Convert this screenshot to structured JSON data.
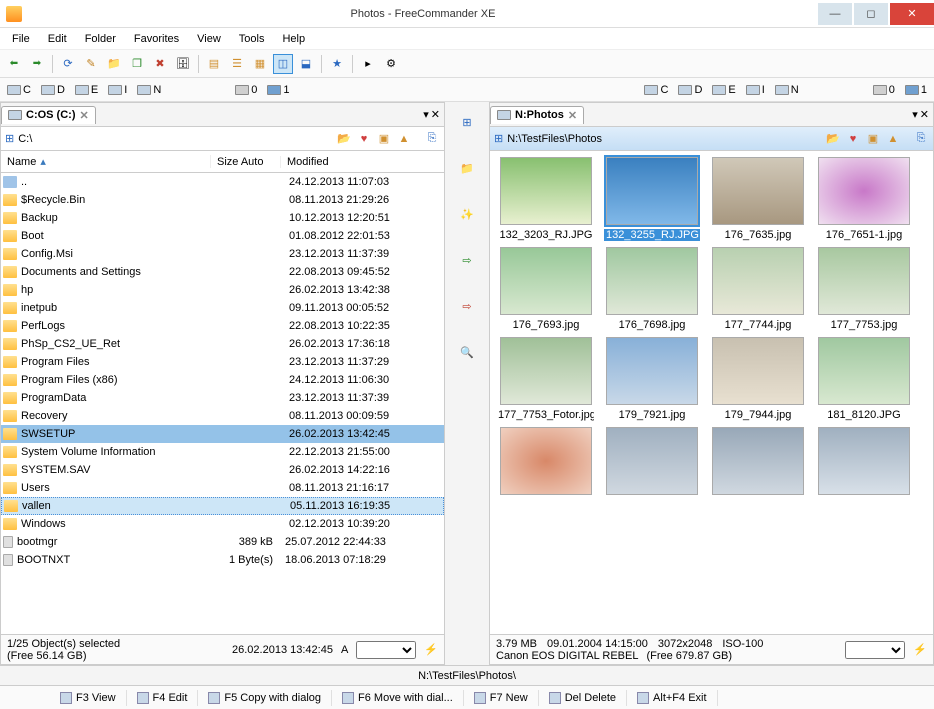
{
  "title": "Photos - FreeCommander XE",
  "menus": [
    "File",
    "Edit",
    "Folder",
    "Favorites",
    "View",
    "Tools",
    "Help"
  ],
  "drives_left": [
    {
      "id": "C",
      "label": "C"
    },
    {
      "id": "D",
      "label": "D"
    },
    {
      "id": "E",
      "label": "E"
    },
    {
      "id": "I",
      "label": "I"
    },
    {
      "id": "N",
      "label": "N"
    }
  ],
  "drives_left_extra": [
    "0",
    "1"
  ],
  "drives_right_extra": [
    "0",
    "1"
  ],
  "left": {
    "tab": "C:OS (C:)",
    "path": "C:\\",
    "columns": {
      "name": "Name",
      "size": "Size Auto",
      "modified": "Modified"
    },
    "rows": [
      {
        "name": "..",
        "size": "",
        "mod": "24.12.2013 11:07:03",
        "icon": "up"
      },
      {
        "name": "$Recycle.Bin",
        "size": "",
        "mod": "08.11.2013 21:29:26"
      },
      {
        "name": "Backup",
        "size": "",
        "mod": "10.12.2013 12:20:51"
      },
      {
        "name": "Boot",
        "size": "",
        "mod": "01.08.2012 22:01:53"
      },
      {
        "name": "Config.Msi",
        "size": "",
        "mod": "23.12.2013 11:37:39"
      },
      {
        "name": "Documents and Settings",
        "size": "",
        "mod": "22.08.2013 09:45:52"
      },
      {
        "name": "hp",
        "size": "",
        "mod": "26.02.2013 13:42:38"
      },
      {
        "name": "inetpub",
        "size": "",
        "mod": "09.11.2013 00:05:52"
      },
      {
        "name": "PerfLogs",
        "size": "",
        "mod": "22.08.2013 10:22:35"
      },
      {
        "name": "PhSp_CS2_UE_Ret",
        "size": "",
        "mod": "26.02.2013 17:36:18"
      },
      {
        "name": "Program Files",
        "size": "",
        "mod": "23.12.2013 11:37:29"
      },
      {
        "name": "Program Files (x86)",
        "size": "",
        "mod": "24.12.2013 11:06:30"
      },
      {
        "name": "ProgramData",
        "size": "",
        "mod": "23.12.2013 11:37:39"
      },
      {
        "name": "Recovery",
        "size": "",
        "mod": "08.11.2013 00:09:59"
      },
      {
        "name": "SWSETUP",
        "size": "",
        "mod": "26.02.2013 13:42:45",
        "state": "sel"
      },
      {
        "name": "System Volume Information",
        "size": "",
        "mod": "22.12.2013 21:55:00"
      },
      {
        "name": "SYSTEM.SAV",
        "size": "",
        "mod": "26.02.2013 14:22:16"
      },
      {
        "name": "Users",
        "size": "",
        "mod": "08.11.2013 21:16:17"
      },
      {
        "name": "vallen",
        "size": "",
        "mod": "05.11.2013 16:19:35",
        "state": "hover"
      },
      {
        "name": "Windows",
        "size": "",
        "mod": "02.12.2013 10:39:20"
      },
      {
        "name": "bootmgr",
        "size": "389 kB",
        "mod": "25.07.2012 22:44:33",
        "icon": "file"
      },
      {
        "name": "BOOTNXT",
        "size": "1 Byte(s)",
        "mod": "18.06.2013 07:18:29",
        "icon": "file"
      }
    ],
    "status1": "1/25 Object(s) selected",
    "status_date": "26.02.2013 13:42:45",
    "status_attr": "A",
    "status2": "(Free 56.14 GB)"
  },
  "right": {
    "tab": "N:Photos",
    "path": "N:\\TestFiles\\Photos",
    "thumbs": [
      {
        "name": "132_3203_RJ.JPG",
        "bg": "linear-gradient(#88c070,#e8f0d0)"
      },
      {
        "name": "132_3255_RJ.JPG",
        "bg": "linear-gradient(#3a80c0,#80b8e8)",
        "sel": true
      },
      {
        "name": "176_7635.jpg",
        "bg": "linear-gradient(#d0c8b8,#a89880)"
      },
      {
        "name": "176_7651-1.jpg",
        "bg": "radial-gradient(#c878c8,#f0e0f0)"
      },
      {
        "name": "176_7693.jpg",
        "bg": "linear-gradient(#98c898,#d8e8d0)"
      },
      {
        "name": "176_7698.jpg",
        "bg": "linear-gradient(#a0c8a0,#e0e8d8)"
      },
      {
        "name": "177_7744.jpg",
        "bg": "linear-gradient(#b8d0b0,#e8e8d8)"
      },
      {
        "name": "177_7753.jpg",
        "bg": "linear-gradient(#a8c8a0,#e0e8d8)"
      },
      {
        "name": "177_7753_Fotor.jpg",
        "bg": "linear-gradient(#a0c098,#e0e8d8)"
      },
      {
        "name": "179_7921.jpg",
        "bg": "linear-gradient(#88b0d8,#c8d8e8)"
      },
      {
        "name": "179_7944.jpg",
        "bg": "linear-gradient(#c8c0b0,#e8e0d0)"
      },
      {
        "name": "181_8120.JPG",
        "bg": "linear-gradient(#a0c8a0,#d8e8d0)"
      },
      {
        "name": "",
        "bg": "radial-gradient(#d88868,#f0d0c0)"
      },
      {
        "name": "",
        "bg": "linear-gradient(#a0b0c0,#d0d8e0)"
      },
      {
        "name": "",
        "bg": "linear-gradient(#98a8b8,#d0d8e0)"
      },
      {
        "name": "",
        "bg": "linear-gradient(#a0b0c0,#d8e0e8)"
      }
    ],
    "status_size": "3.79 MB",
    "status_date": "09.01.2004 14:15:00",
    "status_dim": "3072x2048",
    "status_iso": "ISO-100",
    "status_camera": "Canon EOS DIGITAL REBEL",
    "status_free": "(Free 679.87 GB)"
  },
  "path_status": "N:\\TestFiles\\Photos\\",
  "fn": [
    {
      "key": "F3",
      "label": "View"
    },
    {
      "key": "F4",
      "label": "Edit"
    },
    {
      "key": "F5",
      "label": "Copy with dialog"
    },
    {
      "key": "F6",
      "label": "Move with dial..."
    },
    {
      "key": "F7",
      "label": "New"
    },
    {
      "key": "",
      "label": "Del Delete"
    },
    {
      "key": "Alt+F4",
      "label": "Exit"
    }
  ]
}
